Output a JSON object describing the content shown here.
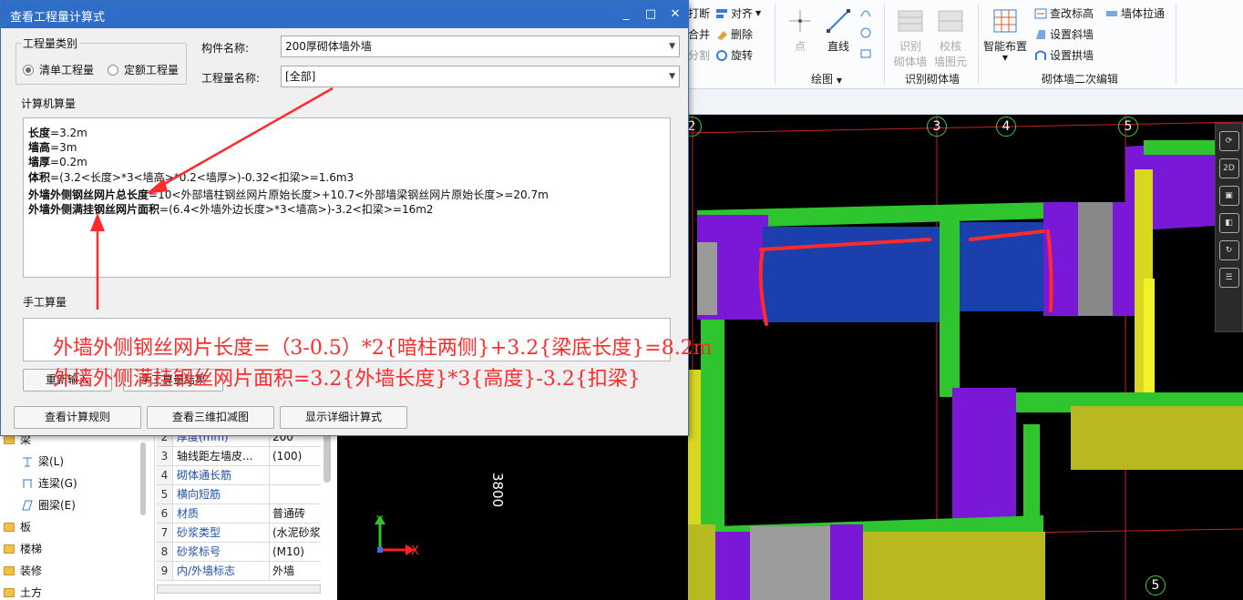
{
  "dialog": {
    "title": "查看工程量计算式",
    "minimize": "_",
    "maximize": "□",
    "close": "✕",
    "qty_type_group": "工程量类别",
    "radio_list": "清单工程量",
    "radio_quota": "定额工程量",
    "component_name_label": "构件名称:",
    "component_name_value": "200厚砌体墙外墙",
    "qty_name_label": "工程量名称:",
    "qty_name_value": "[全部]",
    "computer_section": "计算机算量",
    "calc_lines": [
      {
        "key": "长度",
        "rest": "=3.2m"
      },
      {
        "key": "墙高",
        "rest": "=3m"
      },
      {
        "key": "墙厚",
        "rest": "=0.2m"
      },
      {
        "key": "体积",
        "rest": "=(3.2<长度>*3<墙高>*0.2<墙厚>)-0.32<扣梁>=1.6m3"
      },
      {
        "key": "外墙外侧钢丝网片总长度",
        "rest": "=10<外部墙柱钢丝网片原始长度>+10.7<外部墙梁钢丝网片原始长度>=20.7m"
      },
      {
        "key": "外墙外侧满挂钢丝网片面积",
        "rest": "=(6.4<外墙外边长度>*3<墙高>)-3.2<扣梁>=16m2"
      }
    ],
    "manual_section": "手工算量",
    "btn_reenter": "重新输入",
    "btn_manual_result": "手工算量结果",
    "btn_view_rules": "查看计算规则",
    "btn_view_3d": "查看三维扣减图",
    "btn_show_detail": "显示详细计算式"
  },
  "annotation": {
    "line1": "外墙外侧钢丝网片长度=（3-0.5）*2{暗柱两侧}+3.2{梁底长度}=8.2m",
    "line2": "外墙外侧满挂钢丝网片面积=3.2{外墙长度}*3{高度}-3.2{扣梁}",
    "color": "#ff2a2a"
  },
  "ribbon": {
    "break": "打断",
    "merge": "合并",
    "split": "分割",
    "align": "对齐",
    "delete": "删除",
    "rotate": "旋转",
    "point": "点",
    "line": "直线",
    "draw_group": "绘图",
    "identify_wall": "识别砌体墙",
    "identify_wall_big": "识别\n砌体墙",
    "check_wall": "校核\n墙图元",
    "smart_layout": "智能布置",
    "edit_elev": "查改标高",
    "set_slope": "设置斜墙",
    "set_arch": "设置拱墙",
    "wall_stretch": "墙体拉通",
    "masonry_edit_group": "砌体墙二次编辑"
  },
  "canvas": {
    "axes": [
      "2",
      "3",
      "4",
      "5",
      "5"
    ],
    "dimension": "3800",
    "x_label": "X",
    "y_label": "Y"
  },
  "tree": [
    {
      "label": "梁",
      "type": "folder"
    },
    {
      "label": "梁(L)",
      "type": "child"
    },
    {
      "label": "连梁(G)",
      "type": "child"
    },
    {
      "label": "圈梁(E)",
      "type": "child"
    },
    {
      "label": "板",
      "type": "folder"
    },
    {
      "label": "楼梯",
      "type": "folder"
    },
    {
      "label": "装修",
      "type": "folder"
    },
    {
      "label": "土方",
      "type": "folder"
    }
  ],
  "props": [
    {
      "n": "2",
      "k": "厚度(mm)",
      "v": "200"
    },
    {
      "n": "3",
      "k": "轴线距左墙皮...",
      "v": "(100)"
    },
    {
      "n": "4",
      "k": "砌体通长筋",
      "v": ""
    },
    {
      "n": "5",
      "k": "横向短筋",
      "v": ""
    },
    {
      "n": "6",
      "k": "材质",
      "v": "普通砖"
    },
    {
      "n": "7",
      "k": "砂浆类型",
      "v": "(水泥砂浆"
    },
    {
      "n": "8",
      "k": "砂浆标号",
      "v": "(M10)"
    },
    {
      "n": "9",
      "k": "内/外墙标志",
      "v": "外墙"
    }
  ]
}
